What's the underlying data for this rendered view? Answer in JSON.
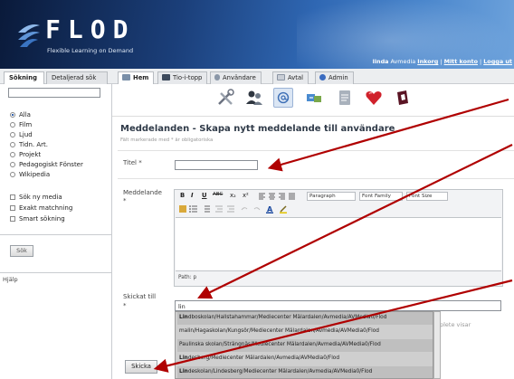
{
  "header": {
    "logo_text": "FLOD",
    "tagline": "Flexible Learning on Demand",
    "user_name": "linda",
    "user_org": "Avmedia",
    "inbox_label": "Inkorg",
    "account_label": "Mitt konto",
    "logout_label": "Logga ut",
    "separator": "|"
  },
  "left_tabs": [
    "Sökning",
    "Detaljerad sök"
  ],
  "main_tabs": [
    "Hem",
    "Tio-i-topp",
    "Användare",
    "Avtal",
    "Admin"
  ],
  "sidebar": {
    "search_value": "",
    "media_options": [
      "Alla",
      "Film",
      "Ljud",
      "Tidn. Art.",
      "Projekt",
      "Pedagogiskt Fönster",
      "Wikipedia"
    ],
    "selected_media": "Alla",
    "checkboxes": [
      "Sök ny media",
      "Exakt matchning",
      "Smart sökning"
    ],
    "search_button": "Sök",
    "help_label": "Hjälp"
  },
  "toolbar_icons": [
    "tools-icon",
    "users-icon",
    "messages-icon",
    "transfer-icon",
    "notes-icon",
    "favorites-heart-icon",
    "box-icon"
  ],
  "page": {
    "title": "Meddelanden - Skapa nytt meddelande till användare",
    "required_note": "Fält markerade med * är obligatoriska",
    "title_label": "Titel *",
    "title_value": "",
    "message_label": "Meddelande",
    "message_required": "*",
    "recipient_label": "Skickat till",
    "recipient_required": "*",
    "recipient_value": "lin",
    "send_button": "Skicka",
    "hidden_text_fragment": "plete visar"
  },
  "editor": {
    "row1_buttons": [
      "B",
      "I",
      "U",
      "ABC",
      "x₂",
      "x²"
    ],
    "format_select": "Paragraph",
    "font_family_select": "Font Family",
    "font_size_select": "Font Size",
    "path_label": "Path: p"
  },
  "autocomplete": [
    {
      "bold": "Lin",
      "rest": "dboskolan/Hallstahammar/Mediecenter Mälardalen/Avmedia/AVMedia0/Flod"
    },
    {
      "bold": "",
      "rest": "malin/Hagaskolan/Kungsör/Mediecenter Mälardalen/Avmedia/AVMedia0/Flod"
    },
    {
      "bold": "",
      "rest": "Paulinska skolan/Strängnäs/Mediecenter Mälardalen/Avmedia/AVMedia0/Flod"
    },
    {
      "bold": "Lin",
      "rest": "desberg/Mediecenter Mälardalen/Avmedia/AVMedia0/Flod"
    },
    {
      "bold": "Lin",
      "rest": "deskolan/Lindesberg/Mediecenter Mälardalen/Avmedia/AVMedia0/Flod"
    }
  ],
  "colors": {
    "header_dark": "#0a1a3a",
    "header_light": "#6ea3dc",
    "annotation_arrow": "#b00000",
    "heart": "#d0212b"
  }
}
